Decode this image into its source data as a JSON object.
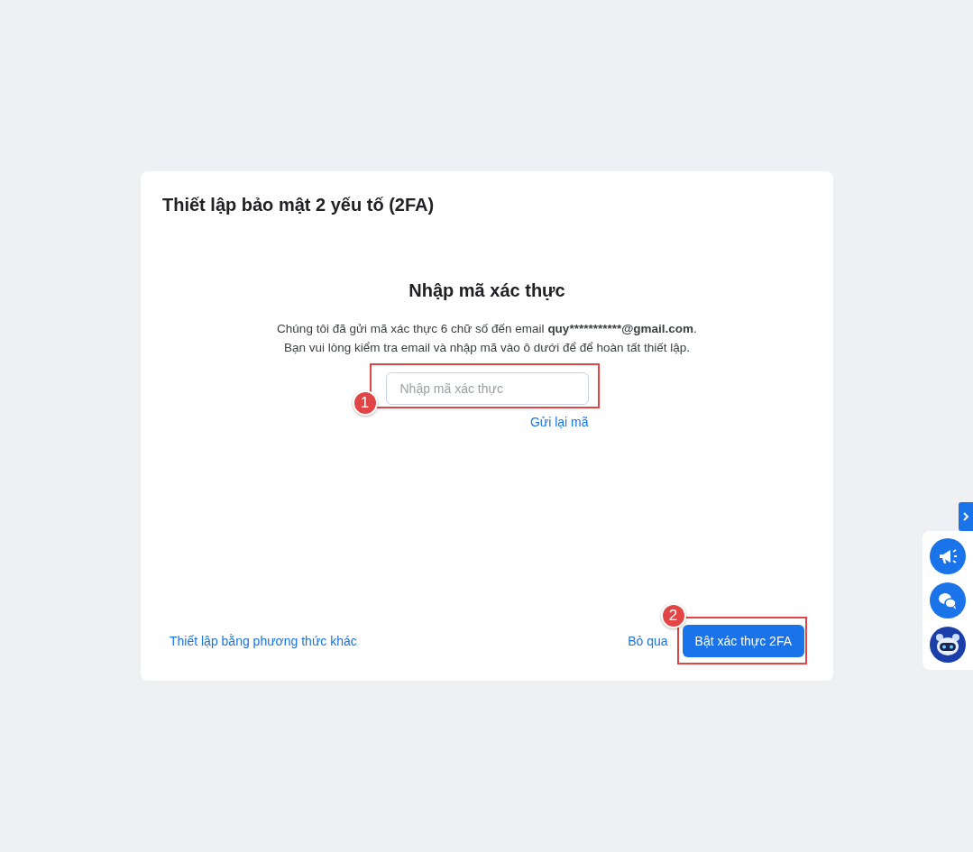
{
  "card": {
    "title": "Thiết lập bảo mật 2 yếu tố (2FA)",
    "heading": "Nhập mã xác thực",
    "message_lines": [
      {
        "text": "Chúng tôi đã gửi mã xác thực 6 chữ số đến email ",
        "email": "quy***********@gmail.com",
        "after": "."
      },
      {
        "text": "Bạn vui lòng kiểm tra email và nhập mã vào ô dưới để để hoàn tất thiết lập."
      }
    ],
    "code_field": {
      "placeholder": "Nhập mã xác thực"
    },
    "resend_link": "Gửi lại mã",
    "alt_method_link": "Thiết lập bằng phương thức khác",
    "skip_link": "Bỏ qua",
    "submit_button": "Bật xác thực 2FA"
  },
  "annotations": [
    {
      "number": "1"
    },
    {
      "number": "2"
    }
  ]
}
